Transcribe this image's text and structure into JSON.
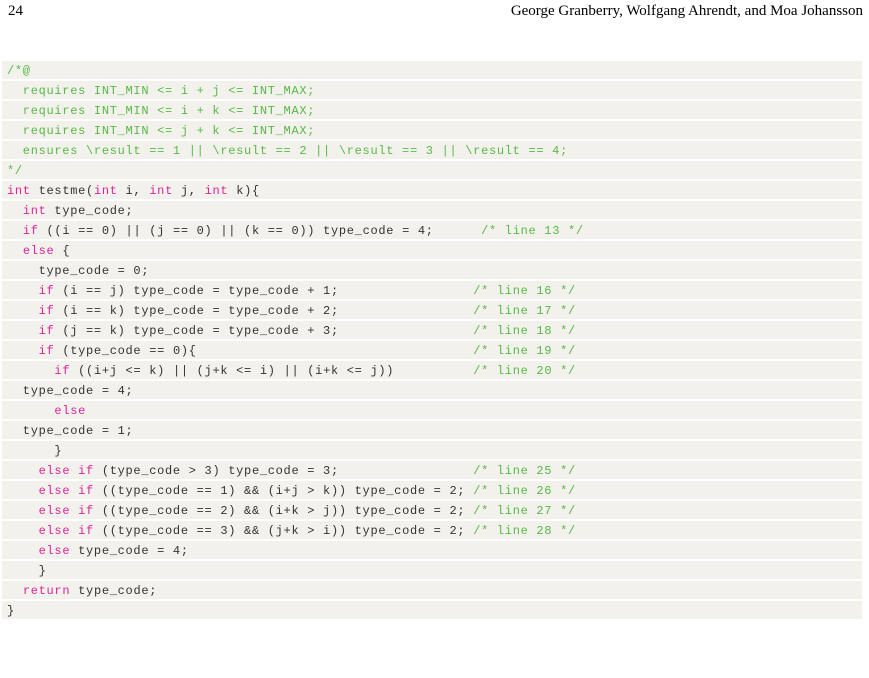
{
  "header": {
    "page_number": "24",
    "authors": "George Granberry, Wolfgang Ahrendt, and Moa Johansson"
  },
  "colors": {
    "comment": "#58b947",
    "keyword": "#e0219b",
    "plain": "#333333",
    "code_background": "#f2f1ec"
  },
  "code": {
    "lines": [
      [
        {
          "t": "/*@",
          "k": "comment"
        }
      ],
      [
        {
          "t": "  requires INT_MIN <= i + j <= INT_MAX;",
          "k": "comment"
        }
      ],
      [
        {
          "t": "  requires INT_MIN <= i + k <= INT_MAX;",
          "k": "comment"
        }
      ],
      [
        {
          "t": "  requires INT_MIN <= j + k <= INT_MAX;",
          "k": "comment"
        }
      ],
      [
        {
          "t": "  ensures \\result == 1 || \\result == 2 || \\result == 3 || \\result == 4;",
          "k": "comment"
        }
      ],
      [
        {
          "t": "*/",
          "k": "comment"
        }
      ],
      [
        {
          "t": "int",
          "k": "keyword"
        },
        {
          "t": " testme(",
          "k": "plain"
        },
        {
          "t": "int",
          "k": "keyword"
        },
        {
          "t": " i, ",
          "k": "plain"
        },
        {
          "t": "int",
          "k": "keyword"
        },
        {
          "t": " j, ",
          "k": "plain"
        },
        {
          "t": "int",
          "k": "keyword"
        },
        {
          "t": " k){",
          "k": "plain"
        }
      ],
      [
        {
          "t": "  ",
          "k": "plain"
        },
        {
          "t": "int",
          "k": "keyword"
        },
        {
          "t": " type_code;",
          "k": "plain"
        }
      ],
      [
        {
          "t": "  ",
          "k": "plain"
        },
        {
          "t": "if",
          "k": "keyword"
        },
        {
          "t": " ((i == 0) || (j == 0) || (k == 0)) type_code = 4;      ",
          "k": "plain"
        },
        {
          "t": "/* line 13 */",
          "k": "comment"
        }
      ],
      [
        {
          "t": "  ",
          "k": "plain"
        },
        {
          "t": "else",
          "k": "keyword"
        },
        {
          "t": " {",
          "k": "plain"
        }
      ],
      [
        {
          "t": "    type_code = 0;",
          "k": "plain"
        }
      ],
      [
        {
          "t": "    ",
          "k": "plain"
        },
        {
          "t": "if",
          "k": "keyword"
        },
        {
          "t": " (i == j) type_code = type_code + 1;                 ",
          "k": "plain"
        },
        {
          "t": "/* line 16 */",
          "k": "comment"
        }
      ],
      [
        {
          "t": "    ",
          "k": "plain"
        },
        {
          "t": "if",
          "k": "keyword"
        },
        {
          "t": " (i == k) type_code = type_code + 2;                 ",
          "k": "plain"
        },
        {
          "t": "/* line 17 */",
          "k": "comment"
        }
      ],
      [
        {
          "t": "    ",
          "k": "plain"
        },
        {
          "t": "if",
          "k": "keyword"
        },
        {
          "t": " (j == k) type_code = type_code + 3;                 ",
          "k": "plain"
        },
        {
          "t": "/* line 18 */",
          "k": "comment"
        }
      ],
      [
        {
          "t": "    ",
          "k": "plain"
        },
        {
          "t": "if",
          "k": "keyword"
        },
        {
          "t": " (type_code == 0){                                   ",
          "k": "plain"
        },
        {
          "t": "/* line 19 */",
          "k": "comment"
        }
      ],
      [
        {
          "t": "      ",
          "k": "plain"
        },
        {
          "t": "if",
          "k": "keyword"
        },
        {
          "t": " ((i+j <= k) || (j+k <= i) || (i+k <= j))          ",
          "k": "plain"
        },
        {
          "t": "/* line 20 */",
          "k": "comment"
        }
      ],
      [
        {
          "t": "  type_code = 4;",
          "k": "plain"
        }
      ],
      [
        {
          "t": "      ",
          "k": "plain"
        },
        {
          "t": "else",
          "k": "keyword"
        }
      ],
      [
        {
          "t": "  type_code = 1;",
          "k": "plain"
        }
      ],
      [
        {
          "t": "      }",
          "k": "plain"
        }
      ],
      [
        {
          "t": "    ",
          "k": "plain"
        },
        {
          "t": "else if",
          "k": "keyword"
        },
        {
          "t": " (type_code > 3) type_code = 3;                 ",
          "k": "plain"
        },
        {
          "t": "/* line 25 */",
          "k": "comment"
        }
      ],
      [
        {
          "t": "    ",
          "k": "plain"
        },
        {
          "t": "else if",
          "k": "keyword"
        },
        {
          "t": " ((type_code == 1) && (i+j > k)) type_code = 2; ",
          "k": "plain"
        },
        {
          "t": "/* line 26 */",
          "k": "comment"
        }
      ],
      [
        {
          "t": "    ",
          "k": "plain"
        },
        {
          "t": "else if",
          "k": "keyword"
        },
        {
          "t": " ((type_code == 2) && (i+k > j)) type_code = 2; ",
          "k": "plain"
        },
        {
          "t": "/* line 27 */",
          "k": "comment"
        }
      ],
      [
        {
          "t": "    ",
          "k": "plain"
        },
        {
          "t": "else if",
          "k": "keyword"
        },
        {
          "t": " ((type_code == 3) && (j+k > i)) type_code = 2; ",
          "k": "plain"
        },
        {
          "t": "/* line 28 */",
          "k": "comment"
        }
      ],
      [
        {
          "t": "    ",
          "k": "plain"
        },
        {
          "t": "else",
          "k": "keyword"
        },
        {
          "t": " type_code = 4;",
          "k": "plain"
        }
      ],
      [
        {
          "t": "    }",
          "k": "plain"
        }
      ],
      [
        {
          "t": "  ",
          "k": "plain"
        },
        {
          "t": "return",
          "k": "keyword"
        },
        {
          "t": " type_code;",
          "k": "plain"
        }
      ],
      [
        {
          "t": "}",
          "k": "plain"
        }
      ]
    ]
  }
}
